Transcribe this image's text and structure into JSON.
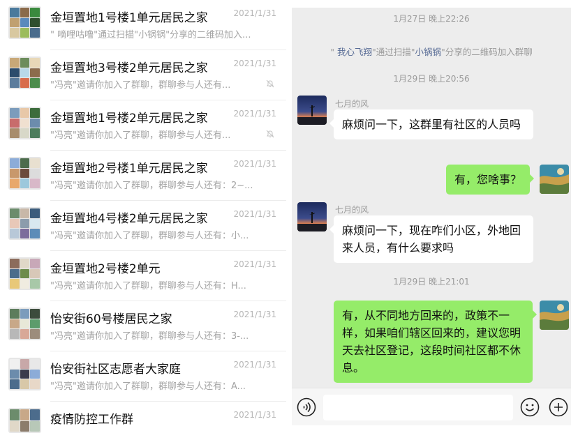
{
  "chat_list": [
    {
      "name": "金垣置地1号楼1单元居民之家",
      "date": "2021/1/31",
      "preview": "\" 嘀哩咕噜\"通过扫描\"小锅锅\"分享的二维码加入...",
      "muted": false
    },
    {
      "name": "金垣置地3号楼2单元居民之家",
      "date": "2021/1/31",
      "preview": "\"冯亮\"邀请你加入了群聊，群聊参与人还有...",
      "muted": true
    },
    {
      "name": "金垣置地1号楼2单元居民之家",
      "date": "2021/1/31",
      "preview": "\"冯亮\"邀请你加入了群聊，群聊参与人还有...",
      "muted": true
    },
    {
      "name": "金垣置地2号楼1单元居民之家",
      "date": "2021/1/31",
      "preview": "\"冯亮\"邀请你加入了群聊，群聊参与人还有：2~...",
      "muted": false
    },
    {
      "name": "金垣置地4号楼2单元居民之家",
      "date": "2021/1/31",
      "preview": "\"冯亮\"邀请你加入了群聊，群聊参与人还有：小...",
      "muted": false
    },
    {
      "name": "金垣置地2号楼2单元",
      "date": "2021/1/31",
      "preview": "\"冯亮\"邀请你加入了群聊，群聊参与人还有：H...",
      "muted": false
    },
    {
      "name": "怡安街60号楼居民之家",
      "date": "2021/1/31",
      "preview": "\"冯亮\"邀请你加入了群聊，群聊参与人还有：3-...",
      "muted": false
    },
    {
      "name": "怡安街社区志愿者大家庭",
      "date": "2021/1/31",
      "preview": "\"冯亮\"邀请你加入了群聊，群聊参与人还有：A...",
      "muted": false
    },
    {
      "name": "疫情防控工作群",
      "date": "2021/1/31",
      "preview": "",
      "muted": false
    }
  ],
  "conversation": {
    "time1": "1月27日 晚上22:26",
    "system": {
      "user1": "我心飞翔",
      "mid": "\"通过扫描\"",
      "user2": "小锅锅",
      "tail": "\"分享的二维码加入群聊"
    },
    "time2": "1月29日 晚上20:56",
    "msg1_sender": "七月的风",
    "msg1_text": "麻烦问一下，这群里有社区的人员吗",
    "reply1": "有，您啥事？",
    "msg2_sender": "七月的风",
    "msg2_text": "麻烦问一下，现在咋们小区，外地回来人员，有什么要求吗",
    "time3": "1月29日 晚上21:01",
    "reply2": "有，从不同地方回来的，政策不一样，如果咱们辖区回来的，建议您明天去社区登记，这段时间社区都不休息。"
  },
  "input_bar": {
    "voice_icon": "voice-icon",
    "emoji_icon": "emoji-icon",
    "plus_icon": "plus-icon",
    "placeholder": ""
  },
  "colors": {
    "bubble_out": "#95ec69",
    "bubble_in": "#ffffff",
    "link": "#576b95",
    "panel_bg": "#ededed"
  }
}
